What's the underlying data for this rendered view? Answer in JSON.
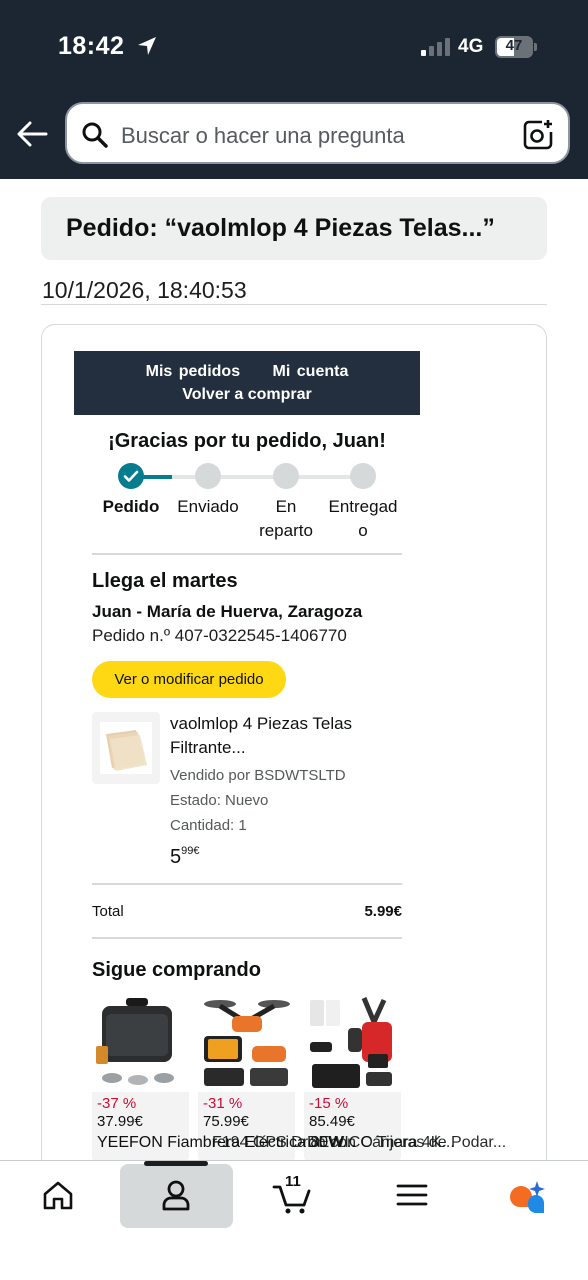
{
  "status_bar": {
    "time": "18:42",
    "network": "4G",
    "battery": "47"
  },
  "header": {
    "search_placeholder": "Buscar o hacer una pregunta"
  },
  "order": {
    "title": "Pedido: “vaolmlop 4 Piezas Telas...”",
    "datetime": "10/1/2026, 18:40:53"
  },
  "email": {
    "nav": {
      "orders": "Mis pedidos",
      "account": "Mi cuenta",
      "buy_again": "Volver a comprar"
    },
    "thanks": "¡Gracias por tu pedido, Juan!",
    "steps": [
      {
        "label": "Pedido",
        "done": true
      },
      {
        "label": "Enviado",
        "done": false
      },
      {
        "label": "En reparto",
        "done": false
      },
      {
        "label": "Entregado",
        "done": false
      }
    ],
    "step_labels": {
      "s1": "Pedido",
      "s2": "Enviado",
      "s3a": "En",
      "s3b": "reparto",
      "s4a": "Entregad",
      "s4b": "o"
    },
    "arrival": "Llega el martes",
    "address": "Juan - María de Huerva, Zaragoza",
    "order_number": "Pedido n.º 407-0322545-1406770",
    "modify_button": "Ver o modificar pedido",
    "item": {
      "name_line1": "vaolmlop 4 Piezas Telas",
      "name_line2": "Filtrante...",
      "seller": "Vendido por BSDWTSLTD",
      "condition": "Estado: Nuevo",
      "quantity": "Cantidad: 1",
      "price_whole": "5",
      "price_fraction": "99€"
    },
    "total_label": "Total",
    "total_value": "5.99€",
    "keep_shopping": "Sigue comprando",
    "recommendations": [
      {
        "discount": "-37 %",
        "price": "37.99€",
        "name": "YEEFON Fiambrera Eléctrica 80W..."
      },
      {
        "discount": "-31 %",
        "price": "75.99€",
        "name": "F194 GPS Dron con Cámara 4K..."
      },
      {
        "discount": "-15 %",
        "price": "85.49€",
        "name": "DEWICO Tijeras de Podar..."
      }
    ],
    "rec_overlap_text": "YEEFON Fiambr F194 GPS Dron DEWICO Tijeras de Podar..."
  },
  "tabbar": {
    "cart_count": "11"
  },
  "colors": {
    "header_bg": "#1c2632",
    "accent_teal": "#067d8e",
    "button_yellow": "#ffd814",
    "discount_red": "#cc0c39"
  }
}
